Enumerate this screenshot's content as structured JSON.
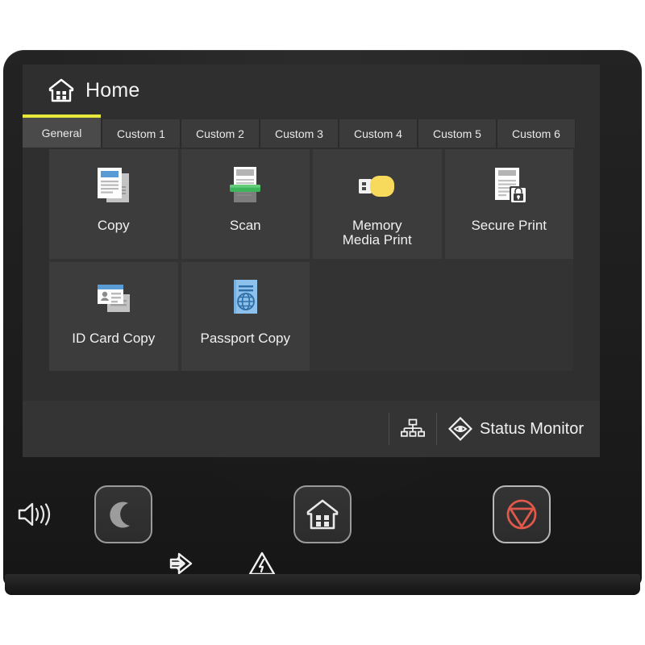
{
  "device": {
    "type": "printer-control-panel"
  },
  "screen": {
    "header": {
      "title": "Home",
      "home_icon": "home-icon"
    },
    "tabs": [
      {
        "label": "General",
        "active": true
      },
      {
        "label": "Custom 1",
        "active": false
      },
      {
        "label": "Custom 2",
        "active": false
      },
      {
        "label": "Custom 3",
        "active": false
      },
      {
        "label": "Custom 4",
        "active": false
      },
      {
        "label": "Custom 5",
        "active": false
      },
      {
        "label": "Custom 6",
        "active": false
      }
    ],
    "tiles": [
      {
        "label": "Copy",
        "icon": "copy-documents-icon"
      },
      {
        "label": "Scan",
        "icon": "scanner-icon"
      },
      {
        "label": "Memory\nMedia Print",
        "icon": "usb-drive-icon"
      },
      {
        "label": "Secure Print",
        "icon": "document-lock-icon"
      },
      {
        "label": "ID Card Copy",
        "icon": "id-card-icon"
      },
      {
        "label": "Passport Copy",
        "icon": "passport-icon"
      }
    ],
    "tile_labels": {
      "copy": "Copy",
      "scan": "Scan",
      "memory_media_print_line1": "Memory",
      "memory_media_print_line2": "Media Print",
      "secure_print": "Secure Print",
      "id_card_copy": "ID Card Copy",
      "passport_copy": "Passport Copy"
    },
    "status_bar": {
      "network_icon": "network-lan-icon",
      "status_monitor_icon": "status-monitor-eye-icon",
      "status_monitor_label": "Status Monitor"
    }
  },
  "hardware": {
    "volume_icon": "speaker-volume-icon",
    "buttons": [
      {
        "name": "energy-saver",
        "icon": "crescent-moon-icon"
      },
      {
        "name": "home",
        "icon": "home-house-icon"
      },
      {
        "name": "stop",
        "icon": "stop-triangle-icon"
      }
    ],
    "indicators": [
      {
        "name": "data",
        "icon": "data-arrow-icon"
      },
      {
        "name": "error",
        "icon": "warning-triangle-icon"
      }
    ]
  },
  "colors": {
    "accent_yellow": "#e8e83c",
    "screen_bg": "#2f2f2f",
    "tile_bg": "#3c3c3c",
    "grid_bg": "#333333",
    "tab_active": "#4a4a4a",
    "tab_inactive": "#3b3b3b",
    "stop_red": "#e0584a",
    "scan_green": "#3fb55b",
    "usb_yellow": "#f7d95c",
    "doc_blue": "#5b9bd5",
    "bezel": "#1d1d1d"
  }
}
